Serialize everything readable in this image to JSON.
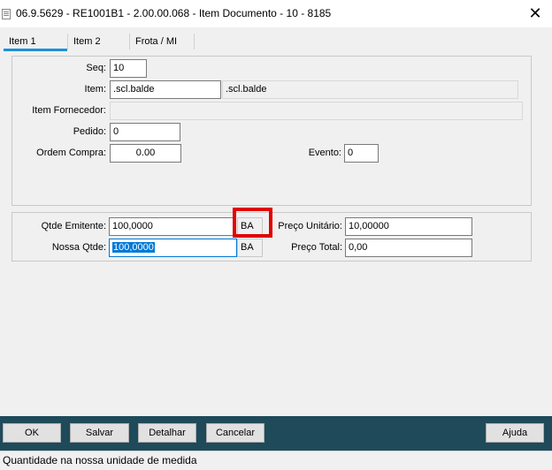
{
  "window": {
    "title": "06.9.5629 - RE1001B1 - 2.00.00.068 - Item Documento - 10 - 8185",
    "close_glyph": "✕"
  },
  "tabs": [
    {
      "label": "Item 1",
      "active": true
    },
    {
      "label": "Item 2",
      "active": false
    },
    {
      "label": "Frota / MI",
      "active": false
    }
  ],
  "form": {
    "seq": {
      "label": "Seq:",
      "value": "10"
    },
    "item": {
      "label": "Item:",
      "value": ".scl.balde",
      "description": ".scl.balde"
    },
    "item_fornecedor": {
      "label": "Item Fornecedor:",
      "value": ""
    },
    "pedido": {
      "label": "Pedido:",
      "value": "0"
    },
    "ordem_compra": {
      "label": "Ordem Compra:",
      "value": "0.00"
    },
    "evento": {
      "label": "Evento:",
      "value": "0"
    }
  },
  "quantities": {
    "qtde_emitente": {
      "label": "Qtde Emitente:",
      "value": "100,0000",
      "unit": "BA"
    },
    "nossa_qtde": {
      "label": "Nossa Qtde:",
      "value": "100,0000",
      "unit": "BA"
    },
    "preco_unitario": {
      "label": "Preço Unitário:",
      "value": "10,00000"
    },
    "preco_total": {
      "label": "Preço Total:",
      "value": "0,00"
    }
  },
  "buttons": {
    "ok": "OK",
    "salvar": "Salvar",
    "detalhar": "Detalhar",
    "cancelar": "Cancelar",
    "ajuda": "Ajuda"
  },
  "status": "Quantidade na nossa unidade de medida",
  "colors": {
    "accent": "#1e90d6",
    "button_bar": "#1e4a5a",
    "highlight": "#e00000",
    "selection": "#0078d7"
  }
}
